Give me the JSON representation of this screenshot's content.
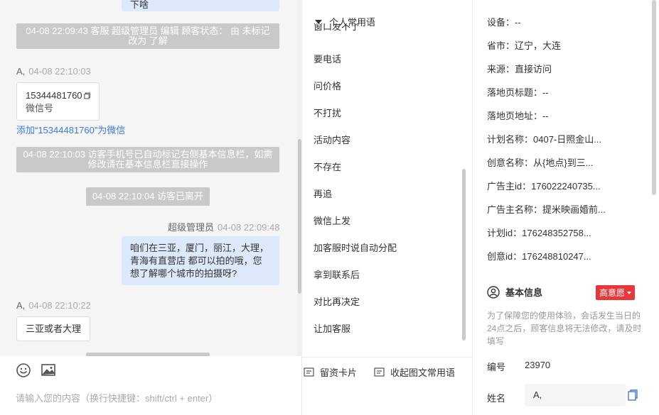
{
  "chat": {
    "top_bubble_tail": "下啥",
    "sys_msg_1_line1": "04-08 22:09:43 客服 超级管理员 编辑 顾客状态： 由 未标记",
    "sys_msg_1_line2": "改为 了解",
    "visitor_name": "A,",
    "visitor_time_1": "04-08 22:10:03",
    "wechat_card_number": "15344481760",
    "wechat_card_label": "微信号",
    "add_wechat_link": "添加“15344481760”为微信",
    "sys_msg_2_line1": "04-08 22:10:03 访客手机号已自动标记右侧基本信息栏，如需",
    "sys_msg_2_line2": "修改请在基本信息栏直接操作",
    "sys_msg_3": "04-08 22:10:04 访客已离开",
    "agent_name": "超级管理员",
    "agent_time": "04-08 22:09:48",
    "agent_msg_line1": "咱们在三亚，厦门，丽江，大理，",
    "agent_msg_line2": "青海有直营店 都可以拍的哦，您",
    "agent_msg_line3": "想了解哪个城市的拍摄呀?",
    "visitor_time_2": "04-08 22:10:22",
    "visitor_msg_2": "三亚或者大理",
    "toolbar": {
      "emoji_icon": "smile-icon",
      "image_icon": "image-icon",
      "card_button": "留资卡片",
      "collapse_button": "收起图文常用语"
    },
    "input_placeholder": "请输入您的内容（换行快捷键：shift/ctrl + enter）"
  },
  "phrases": {
    "group_title": "个人常用语",
    "partial_item": "窗口发不了",
    "items": [
      "要电话",
      "问价格",
      "不打扰",
      "活动内容",
      "不存在",
      "再追",
      "微信上发",
      "加客服时说自动分配",
      "拿到联系后",
      "对比再决定",
      "让加客服"
    ]
  },
  "info": {
    "rows": [
      {
        "label": "设备：",
        "value": "--"
      },
      {
        "label": "省市：",
        "value": "辽宁，大连"
      },
      {
        "label": "来源：",
        "value": "直接访问"
      },
      {
        "label": "落地页标题：",
        "value": "--"
      },
      {
        "label": "落地页地址：",
        "value": "--"
      },
      {
        "label": "计划名称：",
        "value": "0407-日照金山..."
      },
      {
        "label": "创意名称：",
        "value": "从{地点}到三..."
      },
      {
        "label": "广告主id：",
        "value": "176022240735..."
      },
      {
        "label": "广告主名称：",
        "value": "提米映画婚前..."
      },
      {
        "label": "计划id：",
        "value": "176248352758..."
      },
      {
        "label": "创意id：",
        "value": "176248810247..."
      }
    ],
    "basic_info_title": "基本信息",
    "intent_badge": "高意愿",
    "notice": "为了保障您的使用体验，会话发生当日的24点之后，顾客信息将无法修改，请及时填写",
    "id_label": "编号",
    "id_value": "23970",
    "name_label": "姓名",
    "name_value": "A,"
  },
  "colors": {
    "accent_blue": "#3b7be0",
    "badge_red": "#e8373b",
    "agent_bubble": "#dce9fb",
    "system_gray": "#c9c9c9"
  }
}
